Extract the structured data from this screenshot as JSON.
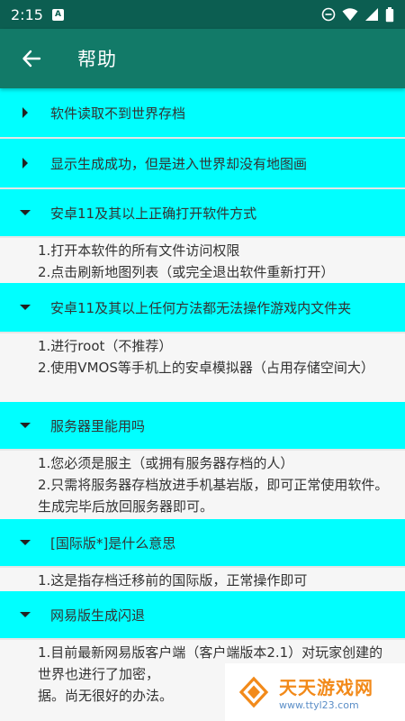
{
  "status_bar": {
    "time": "2:15",
    "notification_badge": "A",
    "icons": [
      "dnd-icon",
      "wifi-icon",
      "signal-icon",
      "battery-icon"
    ]
  },
  "app_bar": {
    "title": "帮助",
    "back_icon": "arrow-left-icon",
    "color": "#127a68"
  },
  "colors": {
    "header_bg": "#00ffff",
    "body_bg": "#f6f6f6",
    "status_bg": "#0c5e51"
  },
  "sections": [
    {
      "title": "软件读取不到世界存档",
      "expanded": false,
      "lines": []
    },
    {
      "title": "显示生成成功，但是进入世界却没有地图画",
      "expanded": false,
      "lines": []
    },
    {
      "title": "安卓11及其以上正确打开软件方式",
      "expanded": true,
      "lines": [
        "1.打开本软件的所有文件访问权限",
        "2.点击刷新地图列表（或完全退出软件重新打开）"
      ]
    },
    {
      "title": "安卓11及其以上任何方法都无法操作游戏内文件夹",
      "expanded": true,
      "lines": [
        "1.进行root（不推荐）",
        "2.使用VMOS等手机上的安卓模拟器（占用存储空间大）"
      ]
    },
    {
      "title": "服务器里能用吗",
      "expanded": true,
      "lines": [
        "1.您必须是服主（或拥有服务器存档的人）",
        "2.只需将服务器存档放进手机基岩版，即可正常使用软件。生成完毕后放回服务器即可。"
      ]
    },
    {
      "title": "[国际版*]是什么意思",
      "expanded": true,
      "lines": [
        "1.这是指存档迁移前的国际版，正常操作即可"
      ]
    },
    {
      "title": "网易版生成闪退",
      "expanded": true,
      "lines": [
        "1.目前最新网易版客户端（客户端版本2.1）对玩家创建的世界也进行了加密，",
        "据。尚无很好的办法。"
      ]
    }
  ],
  "watermark": {
    "text": "天天游戏网",
    "url": "www.ttyl23.com"
  }
}
